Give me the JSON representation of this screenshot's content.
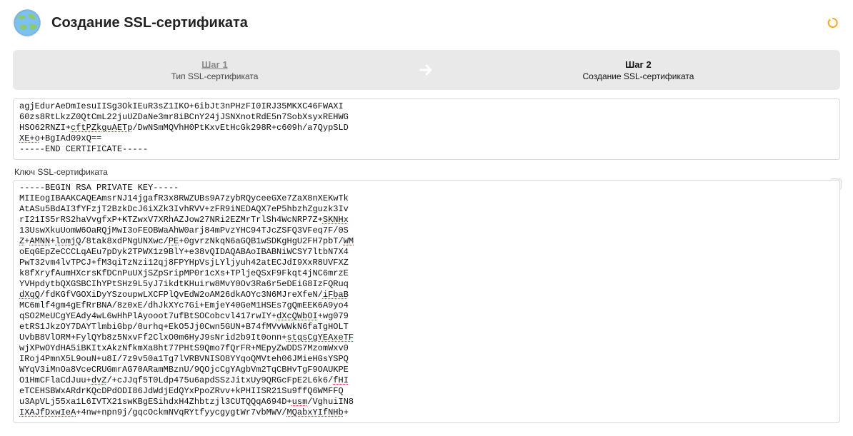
{
  "header": {
    "title": "Создание SSL-сертификата"
  },
  "wizard": {
    "step1": {
      "title": "Шаг 1",
      "sub": "Тип SSL-сертификата"
    },
    "step2": {
      "title": "Шаг 2",
      "sub": "Создание SSL-сертификата"
    }
  },
  "cert_block": {
    "lines": [
      "agjEdurAeDmIesuIISg3OkIEuR3sZ1IKO+6ibJt3nPHzFI0IRJ35MKXC46FWAXI",
      "60zs8RtLkzZ0QtCmL22juUZDaNe3mr8iBCnY24jJSNXnotRdE5n7SobXsyxREHWG",
      "HSO62RNZI+<span class=\"u\">cftPZkguAETp</span>/DwNSmMQVhH0PtKxvEtHcGk298R+c609h/a7QypSLD",
      "<span class=\"u\">XE+o</span>+BgIAd09xQ==",
      "-----END CERTIFICATE-----"
    ]
  },
  "key_label": "Ключ SSL-сертификата",
  "help_char": "?",
  "key_block": {
    "lines": [
      "-----BEGIN RSA PRIVATE KEY-----",
      "MIIEogIBAAKCAQEAmsrNJ14jgafR3x8RWZUBs9A7zybRQyceeGXe7ZaX8nXEKwTk",
      "AtASu5BdAI3fYFzjT2BzkDcJ6iXZk3IvhRVV+zFR9iNEDAQX7eP5hbzhZguzk3Iv",
      "rI21IS5rRS2haVvgfxP+KTZwxV7XRhAZJow27NRi2EZMrTrlSh4WcNRP7Z+<span class=\"u\">SKNHx</span>",
      "13UswXkuUomW6OaRQjMwI3oFEOBWaAhW0arj84mPvzYHC94TJcZSFQ3VFeq7F/0S",
      "<span class=\"u\">Z</span>+<span class=\"u\">AMNN</span>+<span class=\"u\">lomjQ</span>/8tak8xdPNgUNXwc/<span class=\"u\">PE</span>+0gvrzNkqN6aGQB1wSDKgHgU2FH7pbT/<span class=\"u\">WM</span>",
      "oEqGEpZeCCCLqAEu7pDyk2TPWX1z9BlY+e38vQIDAQABAoIBABNiWCSY7ltbN7X4",
      "PwT32vm4lvTPCJ+fM3qiTzNzi12qj8FPYHpVsjLYljyuh42atECJdI9XxR8UVFXZ",
      "k8fXryfAumHXcrsKfDCnPuUXjSZpSripMP0r1cXs+TPljeQSxF9Fkqt4jNC6mrzE",
      "YVHpdytbQXGSBCIhYPtSHz9L5yJ7ikdtKHuirw8MvY0Ov3Ra6r5eDEiG8IzFQRuq",
      "<span class=\"u\">dXqQ</span>/fdKGfVGOXiDyYSzoupwLXCFPlQvEdW2oAM26dkAOYc3N6MJreXfeN/<span class=\"u\">iFbaB</span>",
      "MC6mlf4gm4gEfRrBNA/8z0xE/dhJkXYc7Gi+EmjeY40GeM1HSEs7gQmEEK6A9yo4",
      "qSO2MeUCgYEAdy4wL6wHhPlAyooot7ufBtSOCobcvl417rwIY+<span class=\"u\">dXcQWbOI</span>+wg079",
      "etRS1JkzOY7DAYTlmbiGbp/0urhq+EkO5Jj0Cwn5GUN+B74fMVvWWkN6faTgHOLT",
      "UvbB8VlORM+FylQYb8z5NxvFf2ClxO0m6HyJ9sNrid2b9It0onn+<span class=\"u\">stqsCgYEAxeTF</span>",
      "wjXPwOYdHA5iBKItxAkzNfkmXa8ht77PHtS9Qmo7fQrFR+MEpyZwDDS7MzomWxv0",
      "IRoj4PmnX5L9ouN+u8I/7z9v50a1Tg7lVRBVNISO8YYqoQMVteh06JMieHGsYSPQ",
      "WYqV3iMnOa8VceCRUGmrAG70ARamMBznU/9QOjcCgYAgbVm2TqCBHvTgF9OAUKPE",
      "O1HmCFlaCdJuu+<span class=\"u\">dvZ</span>/+cJJqf5T0Ldp475u6apdSSzJitxUy9QRGcFpE2L6k6/<span class=\"u\">fHI</span>",
      "eTCEHSBWxARdrKQcDPdODI86JdWdjEdQYxPpoZRvv+kPHIISR21Su9ffQ6WMFFQ",
      "u3ApVLj55xa1L6IVTX21swKBgESihdxH4Zhbtzjl3CUTQQqA694D+<span class=\"u\">usm</span>/VghuiIN8",
      "<span class=\"u\">IXAJfDxwIeA</span>+4nw+npn9j/gqcOckmNVqRYtfyycgygtWr7vbMWV/<span class=\"u\">MQabxYIfNHb</span>+"
    ]
  }
}
